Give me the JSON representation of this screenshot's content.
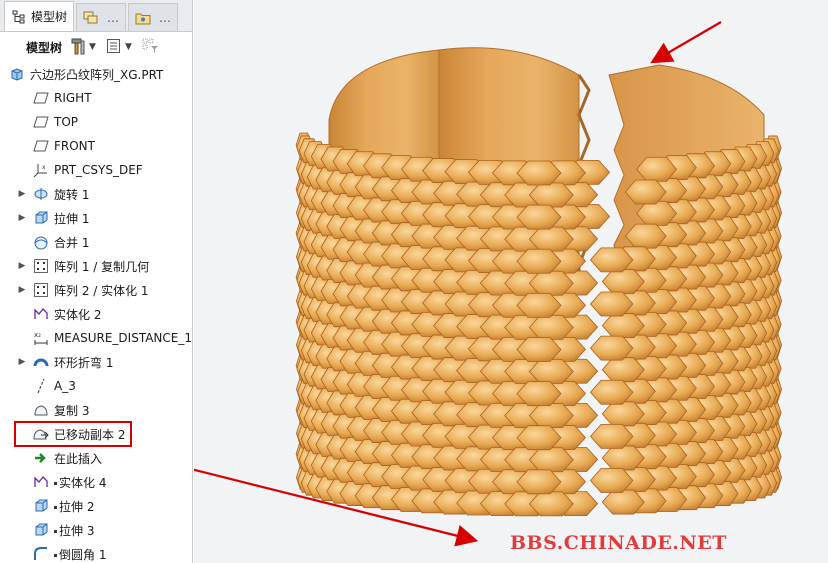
{
  "tabs": [
    {
      "label": "模型树"
    },
    {
      "label": "…"
    },
    {
      "label": "…"
    }
  ],
  "toolbar": {
    "label": "模型树"
  },
  "tree": {
    "root": "六边形凸纹阵列_XG.PRT",
    "items": [
      {
        "label": "RIGHT",
        "icon": "datum-plane-icon",
        "expandable": false
      },
      {
        "label": "TOP",
        "icon": "datum-plane-icon",
        "expandable": false
      },
      {
        "label": "FRONT",
        "icon": "datum-plane-icon",
        "expandable": false
      },
      {
        "label": "PRT_CSYS_DEF",
        "icon": "coordinate-system-icon",
        "expandable": false
      },
      {
        "label": "旋转 1",
        "icon": "revolve-icon",
        "expandable": true
      },
      {
        "label": "拉伸 1",
        "icon": "extrude-icon",
        "expandable": true
      },
      {
        "label": "合并 1",
        "icon": "merge-icon",
        "expandable": false
      },
      {
        "label": "阵列 1 / 复制几何",
        "icon": "pattern-icon",
        "expandable": true
      },
      {
        "label": "阵列 2 / 实体化 1",
        "icon": "pattern-icon",
        "expandable": true
      },
      {
        "label": "实体化 2",
        "icon": "solidify-icon",
        "expandable": false
      },
      {
        "label": "MEASURE_DISTANCE_1",
        "icon": "measure-icon",
        "expandable": false
      },
      {
        "label": "环形折弯 1",
        "icon": "toroidal-bend-icon",
        "expandable": true
      },
      {
        "label": "A_3",
        "icon": "axis-icon",
        "expandable": false
      },
      {
        "label": "复制 3",
        "icon": "copy-icon",
        "expandable": false
      },
      {
        "label": "已移动副本 2",
        "icon": "moved-copy-icon",
        "expandable": false
      },
      {
        "label": "在此插入",
        "icon": "insert-here-icon",
        "expandable": false
      },
      {
        "label": "实体化 4",
        "icon": "solidify-icon",
        "expandable": false
      },
      {
        "label": "拉伸 2",
        "icon": "extrude-icon",
        "expandable": false
      },
      {
        "label": "拉伸 3",
        "icon": "extrude-icon",
        "expandable": false
      },
      {
        "label": "倒圆角 1",
        "icon": "round-icon",
        "expandable": false
      }
    ]
  },
  "watermark": "BBS.CHINADE.NET",
  "colors": {
    "highlight": "#d60000",
    "arrow": "#d60000",
    "part": "#e2a153",
    "watermark": "#e23b3b"
  }
}
